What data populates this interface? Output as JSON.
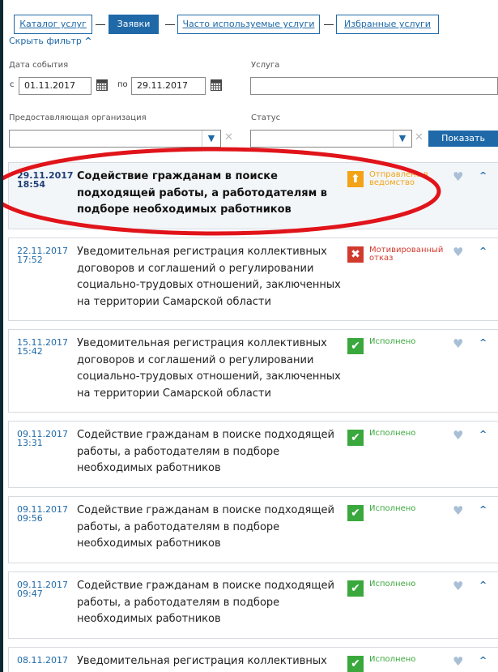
{
  "tabs": [
    {
      "label": "Каталог услуг",
      "active": false
    },
    {
      "label": "Заявки",
      "active": true
    },
    {
      "label": "Часто используемые услуги",
      "active": false
    },
    {
      "label": "Избранные услуги",
      "active": false
    }
  ],
  "filter": {
    "hide_label": "Скрыть фильтр",
    "date_label": "Дата события",
    "from_prefix": "с",
    "date_from": "01.11.2017",
    "to_prefix": "по",
    "date_to": "29.11.2017",
    "service_label": "Услуга",
    "service_value": "",
    "org_label": "Предоставляющая организация",
    "org_value": "",
    "status_label": "Статус",
    "status_value": "",
    "show_button": "Показать"
  },
  "applications": [
    {
      "date": "29.11.2017",
      "time": "18:54",
      "title": "Содействие гражданам в поиске подходящей работы, а работодателям в подборе необходимых работников",
      "status": "Отправлено в ведомство",
      "status_type": "sent",
      "status_icon": "upload-icon",
      "highlighted": true
    },
    {
      "date": "22.11.2017",
      "time": "17:52",
      "title": "Уведомительная регистрация коллективных договоров и соглашений о регулировании социально-трудовых отношений, заключенных на территории Самарской области",
      "status": "Мотивированный отказ",
      "status_type": "rejected",
      "status_icon": "cross-icon",
      "highlighted": false
    },
    {
      "date": "15.11.2017",
      "time": "15:42",
      "title": "Уведомительная регистрация коллективных договоров и соглашений о регулировании социально-трудовых отношений, заключенных на территории Самарской области",
      "status": "Исполнено",
      "status_type": "done",
      "status_icon": "check-icon",
      "highlighted": false
    },
    {
      "date": "09.11.2017",
      "time": "13:31",
      "title": "Содействие гражданам в поиске подходящей работы, а работодателям в подборе необходимых работников",
      "status": "Исполнено",
      "status_type": "done",
      "status_icon": "check-icon",
      "highlighted": false
    },
    {
      "date": "09.11.2017",
      "time": "09:56",
      "title": "Содействие гражданам в поиске подходящей работы, а работодателям в подборе необходимых работников",
      "status": "Исполнено",
      "status_type": "done",
      "status_icon": "check-icon",
      "highlighted": false
    },
    {
      "date": "09.11.2017",
      "time": "09:47",
      "title": "Содействие гражданам в поиске подходящей работы, а работодателям в подборе необходимых работников",
      "status": "Исполнено",
      "status_type": "done",
      "status_icon": "check-icon",
      "highlighted": false
    },
    {
      "date": "08.11.2017",
      "time": "",
      "title": "Уведомительная регистрация коллективных",
      "status": "Исполнено",
      "status_type": "done",
      "status_icon": "check-icon",
      "highlighted": false
    }
  ],
  "colors": {
    "accent": "#1f69a8",
    "done": "#3aa83d",
    "sent": "#f2a316",
    "rejected": "#d13b2e",
    "annotation": "#e0141a"
  }
}
